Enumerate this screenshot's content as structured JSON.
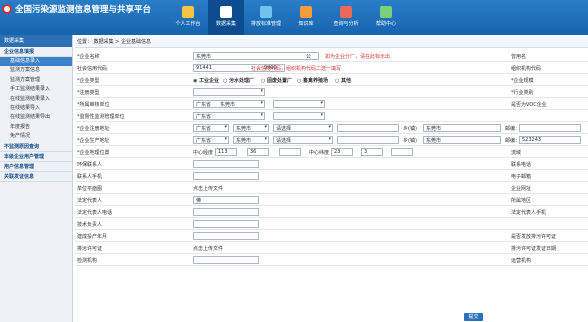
{
  "app": {
    "title": "全国污染源监测信息管理与共享平台"
  },
  "nav": [
    {
      "label": "个人工作台",
      "color": "#f6c340"
    },
    {
      "label": "数据采集",
      "color": "#ffffff"
    },
    {
      "label": "排放标准管理",
      "color": "#6fc3f0"
    },
    {
      "label": "知识库",
      "color": "#f29b3b"
    },
    {
      "label": "查询与分析",
      "color": "#e86a5a"
    },
    {
      "label": "帮助中心",
      "color": "#7bd17b"
    }
  ],
  "sidebar": {
    "head": "数据采集",
    "g1": "企业信息填报",
    "items": [
      "基础信息录入",
      "监测方案信息",
      "监测方案管理",
      "手工监测结果录入",
      "在线监测结果录入",
      "在线结果导入",
      "在线监测结果导出",
      "年度报告",
      "免产情况"
    ],
    "g2": "不监测原因查询",
    "g3": "本级企业用户管理",
    "g4": "用户信息管理",
    "g5": "关联发证信息"
  },
  "breadcrumb": "位置： 数据采集 > 企业基础信息",
  "form": {
    "name_label": "*企业名称",
    "name_value": "东莞市",
    "name_suffix": "公",
    "name_warn": "如为企业分厂，请在此标示出",
    "alias_label": "曾用名",
    "credit_label": "社会信用代码",
    "credit_prefix": "91441",
    "credit_suffix": "9900",
    "credit_warn": "社会信用代码，组织机构代码二选一填写",
    "org_label": "组织机构代码",
    "type_label": "*企业类型",
    "types": [
      "工业企业",
      "污水处理厂",
      "固废处置厂",
      "畜禽养殖场",
      "其他"
    ],
    "scale_label": "*企业规模",
    "reg_type_label": "*注册类型",
    "industry_label": "*行业类别",
    "env_unit_label": "*所属审核单位",
    "province": "广东省",
    "city": "东莞市",
    "voc_label": "是否为VOC企业",
    "monitor_unit_label": "*监督性监测管理单位",
    "reg_addr_label": "*企业注册地址",
    "select_placeholder": "请选择",
    "town_label": "乡(镇)",
    "town_value": "东莞市",
    "zip_label": "邮编：",
    "prod_addr_label": "*企业生产地址",
    "zip_value": "523243",
    "coord_label": "*企业地理位置",
    "lng_label": "中心经度",
    "lng_deg": "113",
    "lng_min": "36",
    "lat_label": "中心纬度",
    "lat_deg": "23",
    "lat_min": "3",
    "basin_label": "流域",
    "env_person_label": "环保联系人",
    "contact_phone_label": "联系电话",
    "contact_mobile_label": "联系人手机",
    "email_label": "电子邮箱",
    "plan_label": "单位平面图",
    "upload_text": "点击上传文件",
    "website_label": "企业网址",
    "legal_label": "法定代表人",
    "legal_value": "佛",
    "region_label": "所属地区",
    "legal_phone_label": "法定代表人电话",
    "legal_mobile_label": "法定代表人手机",
    "tech_person_label": "技术负责人",
    "build_date_label": "建成投产年月",
    "permit_label": "是否发放排污许可证",
    "permit_file_label": "排污许可证",
    "permit_date_label": "排污许可证发证日期",
    "monitor_org_label": "检测机构",
    "transport_label": "运营机构"
  },
  "submit": "提交"
}
